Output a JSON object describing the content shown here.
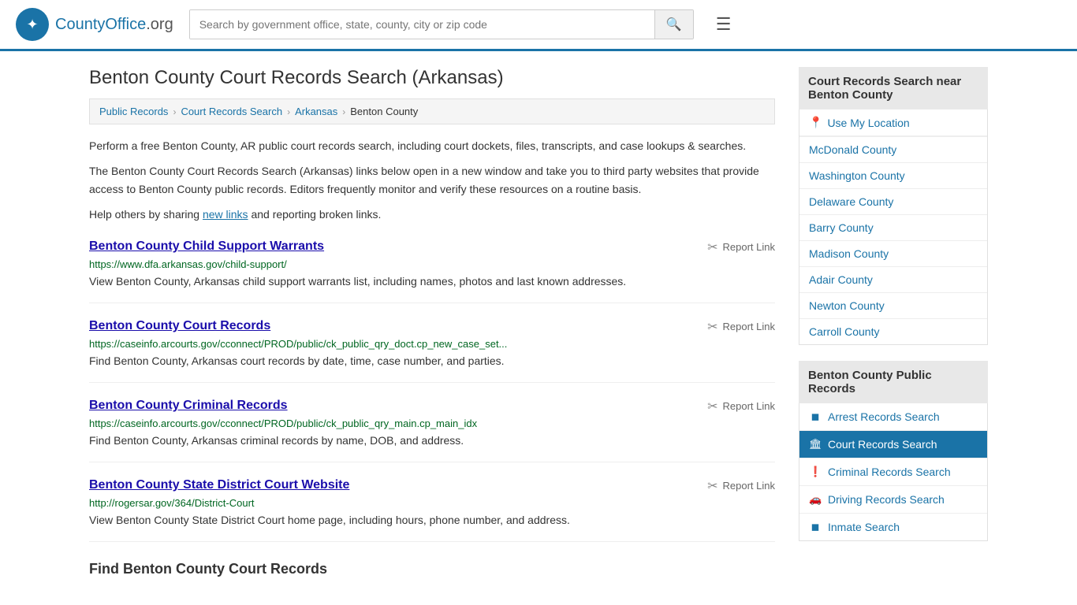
{
  "header": {
    "logo_text": "CountyOffice",
    "logo_tld": ".org",
    "search_placeholder": "Search by government office, state, county, city or zip code",
    "search_icon": "🔍",
    "menu_icon": "☰"
  },
  "page": {
    "title": "Benton County Court Records Search (Arkansas)",
    "breadcrumbs": [
      {
        "label": "Public Records",
        "href": "#"
      },
      {
        "label": "Court Records Search",
        "href": "#"
      },
      {
        "label": "Arkansas",
        "href": "#"
      },
      {
        "label": "Benton County",
        "href": "#"
      }
    ],
    "description1": "Perform a free Benton County, AR public court records search, including court dockets, files, transcripts, and case lookups & searches.",
    "description2": "The Benton County Court Records Search (Arkansas) links below open in a new window and take you to third party websites that provide access to Benton County public records. Editors frequently monitor and verify these resources on a routine basis.",
    "description3_pre": "Help others by sharing ",
    "description3_link": "new links",
    "description3_post": " and reporting broken links.",
    "results": [
      {
        "title": "Benton County Child Support Warrants",
        "url": "https://www.dfa.arkansas.gov/child-support/",
        "desc": "View Benton County, Arkansas child support warrants list, including names, photos and last known addresses.",
        "report_label": "Report Link"
      },
      {
        "title": "Benton County Court Records",
        "url": "https://caseinfo.arcourts.gov/cconnect/PROD/public/ck_public_qry_doct.cp_new_case_set...",
        "desc": "Find Benton County, Arkansas court records by date, time, case number, and parties.",
        "report_label": "Report Link"
      },
      {
        "title": "Benton County Criminal Records",
        "url": "https://caseinfo.arcourts.gov/cconnect/PROD/public/ck_public_qry_main.cp_main_idx",
        "desc": "Find Benton County, Arkansas criminal records by name, DOB, and address.",
        "report_label": "Report Link"
      },
      {
        "title": "Benton County State District Court Website",
        "url": "http://rogersar.gov/364/District-Court",
        "desc": "View Benton County State District Court home page, including hours, phone number, and address.",
        "report_label": "Report Link"
      }
    ],
    "find_heading": "Find Benton County Court Records"
  },
  "sidebar": {
    "nearby_title": "Court Records Search near Benton County",
    "use_location": "Use My Location",
    "nearby_counties": [
      {
        "label": "McDonald County"
      },
      {
        "label": "Washington County"
      },
      {
        "label": "Delaware County"
      },
      {
        "label": "Barry County"
      },
      {
        "label": "Madison County"
      },
      {
        "label": "Adair County"
      },
      {
        "label": "Newton County"
      },
      {
        "label": "Carroll County"
      }
    ],
    "public_records_title": "Benton County Public Records",
    "public_records": [
      {
        "label": "Arrest Records Search",
        "icon": "◼",
        "active": false
      },
      {
        "label": "Court Records Search",
        "icon": "🏛",
        "active": true
      },
      {
        "label": "Criminal Records Search",
        "icon": "❗",
        "active": false
      },
      {
        "label": "Driving Records Search",
        "icon": "🚗",
        "active": false
      },
      {
        "label": "Inmate Search",
        "icon": "◼",
        "active": false
      }
    ]
  }
}
